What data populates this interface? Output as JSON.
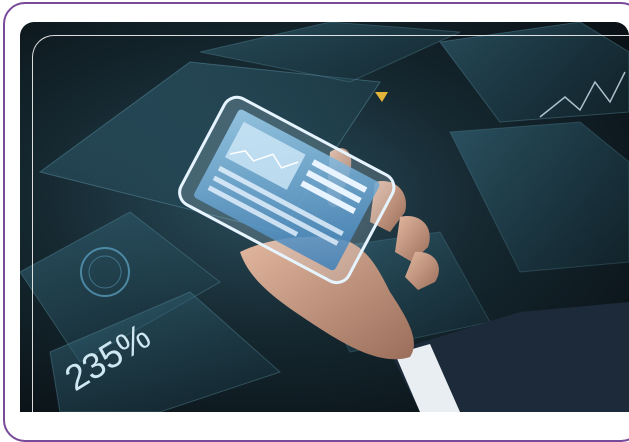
{
  "photo": {
    "overlay_value": "235%",
    "colors": {
      "frame": "#7a4a9a",
      "background_dark": "#070c10",
      "panel_teal": "#2e5f70",
      "screen_blue": "#5fa7d8",
      "skin": "#c79a80",
      "suit": "#1c2a3a",
      "accent_yellow": "#e2b43a"
    },
    "icons": [
      "smartphone-icon",
      "hand-icon",
      "holographic-panel-icon",
      "line-chart-icon",
      "circle-gauge-icon"
    ]
  }
}
